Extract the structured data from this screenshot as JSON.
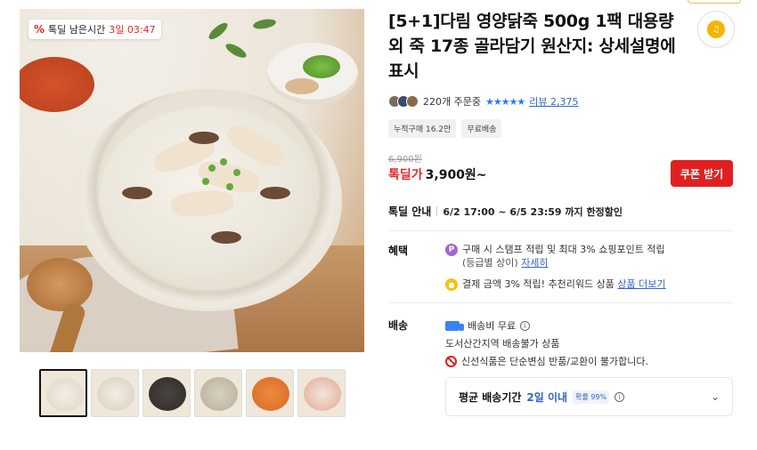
{
  "product": {
    "title": "[5+1]다림 영양닭죽 500g 1팩 대용량 외 죽 17종 골라담기 원산지: 상세설명에 표시",
    "deal_badge": {
      "label": "톡딜 남은시간",
      "time": "3일 03:47",
      "icon": "percent-icon"
    },
    "order_count": "220개 주문중",
    "stars": "★★★★★",
    "review_label": "리뷰 2,375",
    "tags": [
      "누적구매 16.2만",
      "무료배송"
    ],
    "original_price": "6,900원",
    "price_label": "톡딜가",
    "price_value": "3,900원~",
    "coupon_button": "쿠폰 받기",
    "deal_info": {
      "label": "톡딜 안내",
      "value": "6/2 17:00 ~ 6/5 23:59 까지 한정할인"
    }
  },
  "benefits": {
    "label": "혜택",
    "item1": {
      "icon": "P",
      "text": "구매 시 스탬프 적립 및 최대 3% 쇼핑포인트 적립",
      "sub": "(등급별 상이)",
      "link": "자세히"
    },
    "item2": {
      "text": "결제 금액 3% 적립! 추천리워드 상품",
      "link": "상품 더보기"
    }
  },
  "shipping": {
    "label": "배송",
    "fee": "배송비 무료",
    "info_icon": "i",
    "restriction": "도서산간지역 배송불가 상품",
    "notice": "신선식품은 단순변심 반품/교환이 불가합니다.",
    "delivery_label": "평균 배송기간",
    "delivery_value": "2일 이내",
    "probability": "확률 99%",
    "chevron": "chevron-down-icon"
  },
  "colors": {
    "accent_red": "#e02020",
    "link_blue": "#3466c2"
  }
}
